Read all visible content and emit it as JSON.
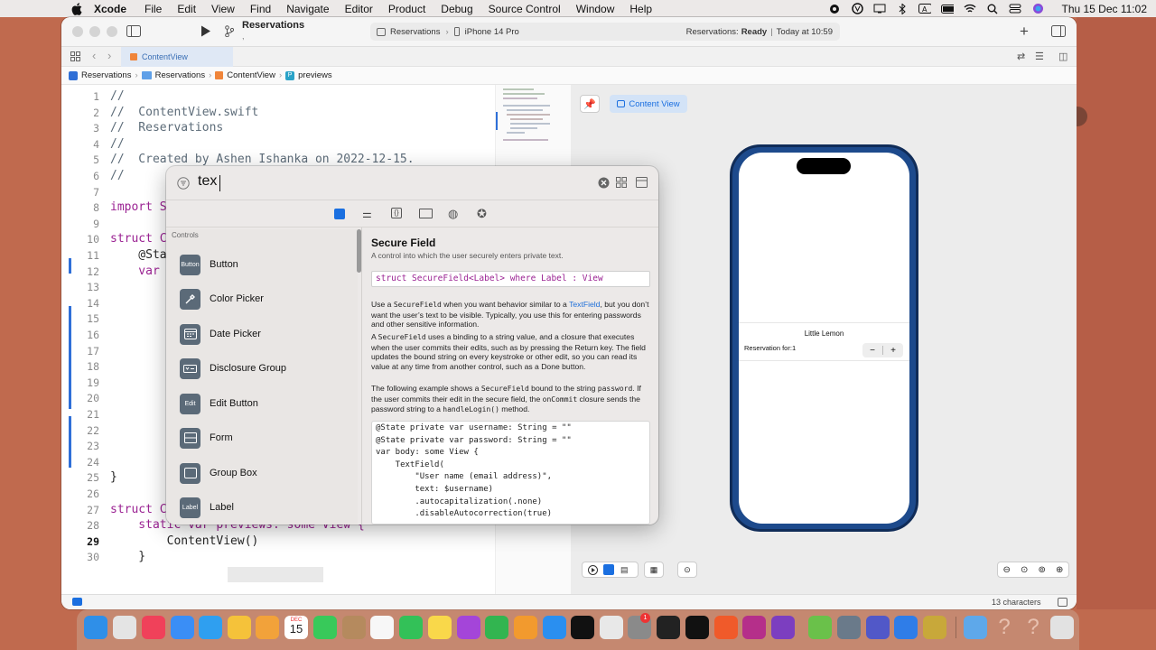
{
  "menubar": {
    "app": "Xcode",
    "items": [
      "File",
      "Edit",
      "View",
      "Find",
      "Navigate",
      "Editor",
      "Product",
      "Debug",
      "Source Control",
      "Window",
      "Help"
    ],
    "clock": "Thu 15 Dec  11:02"
  },
  "toolbar": {
    "scheme_title": "Reservations",
    "scheme_sub": ",",
    "destination_scheme": "Reservations",
    "destination_device": "iPhone 14 Pro",
    "status_prefix": "Reservations:",
    "status_state": "Ready",
    "status_time": "Today at 10:59"
  },
  "tab": {
    "label": "ContentView"
  },
  "breadcrumb": [
    "Reservations",
    "Reservations",
    "ContentView",
    "previews"
  ],
  "code_lines": [
    {
      "n": "1",
      "text": "//"
    },
    {
      "n": "2",
      "text": "//  ContentView.swift"
    },
    {
      "n": "3",
      "text": "//  Reservations"
    },
    {
      "n": "4",
      "text": "//"
    },
    {
      "n": "5",
      "text": "//  Created by Ashen Ishanka on 2022-12-15."
    },
    {
      "n": "6",
      "text": "//"
    },
    {
      "n": "7",
      "text": ""
    },
    {
      "n": "8",
      "text": "import S"
    },
    {
      "n": "9",
      "text": ""
    },
    {
      "n": "10",
      "text": "struct C"
    },
    {
      "n": "11",
      "text": "    @Sta"
    },
    {
      "n": "12",
      "text": "    var"
    },
    {
      "n": "13",
      "text": ""
    },
    {
      "n": "14",
      "text": ""
    },
    {
      "n": "15",
      "text": ""
    },
    {
      "n": "16",
      "text": ""
    },
    {
      "n": "17",
      "text": ""
    },
    {
      "n": "18",
      "text": ""
    },
    {
      "n": "19",
      "text": ""
    },
    {
      "n": "20",
      "text": ""
    },
    {
      "n": "21",
      "text": ""
    },
    {
      "n": "22",
      "text": ""
    },
    {
      "n": "23",
      "text": ""
    },
    {
      "n": "24",
      "text": "        }"
    },
    {
      "n": "25",
      "text": "}"
    },
    {
      "n": "26",
      "text": ""
    },
    {
      "n": "27",
      "text": "struct ContentView_Previews: PreviewProvider {"
    },
    {
      "n": "28",
      "text": "    static var previews: some View {"
    },
    {
      "n": "29",
      "text": "        ContentView()"
    },
    {
      "n": "30",
      "text": "    }"
    }
  ],
  "canvas": {
    "preview_label": "Content View"
  },
  "preview": {
    "title": "Little Lemon",
    "stepper_label": "Reservation for:1",
    "minus": "−",
    "plus": "+"
  },
  "statusbar": {
    "count": "13 characters"
  },
  "library": {
    "search_value": "tex",
    "section": "Controls",
    "items": [
      {
        "label": "Button",
        "icon": "Button"
      },
      {
        "label": "Color Picker",
        "icon": "eyedropper"
      },
      {
        "label": "Date Picker",
        "icon": "calendar"
      },
      {
        "label": "Disclosure Group",
        "icon": "disclosure"
      },
      {
        "label": "Edit Button",
        "icon": "Edit"
      },
      {
        "label": "Form",
        "icon": "form"
      },
      {
        "label": "Group Box",
        "icon": "groupbox"
      },
      {
        "label": "Label",
        "icon": "Label"
      }
    ],
    "detail": {
      "title": "Secure Field",
      "subtitle": "A control into which the user securely enters private text.",
      "declaration": "struct SecureField<Label> where Label : View",
      "p1a": "Use a ",
      "p1_code": "SecureField",
      "p1b": " when you want behavior similar to a ",
      "p1_link": "TextField",
      "p1c": ", but you don’t want the user’s text to be visible. Typically, you use this for entering passwords and other sensitive information.",
      "p2a": "A ",
      "p2_code": "SecureField",
      "p2b": " uses a binding to a string value, and a closure that executes when the user commits their edits, such as by pressing the Return key. The field updates the bound string on every keystroke or other edit, so you can read its value at any time from another control, such as a Done button.",
      "p3a": "The following example shows a ",
      "p3_code1": "SecureField",
      "p3b": " bound to the string ",
      "p3_code2": "password",
      "p3c": ". If the user commits their edit in the secure field, the ",
      "p3_code3": "onCommit",
      "p3d": " closure sends the password string to a ",
      "p3_code4": "handleLogin()",
      "p3e": " method.",
      "code": [
        "@State private var username: String = \"\"",
        "@State private var password: String = \"\"",
        "",
        "var body: some View {",
        "    TextField(",
        "        \"User name (email address)\",",
        "        text: $username)",
        "        .autocapitalization(.none)",
        "        .disableAutocorrection(true)"
      ]
    }
  },
  "dock": {
    "calendar_month": "DEC",
    "calendar_day": "15",
    "badge": "1"
  },
  "colors": {
    "accent": "#1a6fe0",
    "phone_frame": "#1d4a8c"
  }
}
